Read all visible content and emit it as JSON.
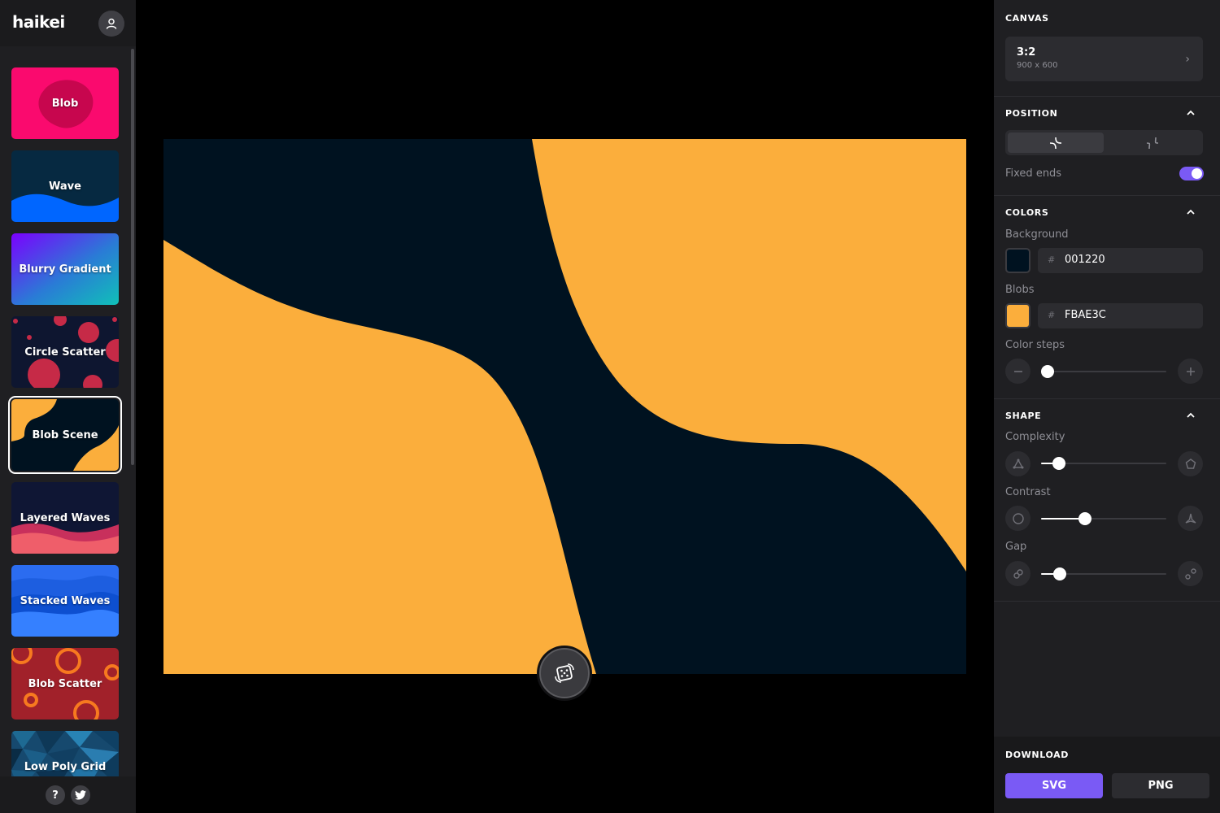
{
  "app": {
    "logo": "haikei"
  },
  "sidebar": {
    "items": [
      {
        "label": "Blob",
        "icon": "blob-thumb"
      },
      {
        "label": "Wave",
        "icon": "wave-thumb"
      },
      {
        "label": "Blurry Gradient",
        "icon": "blurry-gradient-thumb"
      },
      {
        "label": "Circle Scatter",
        "icon": "circle-scatter-thumb"
      },
      {
        "label": "Blob Scene",
        "icon": "blob-scene-thumb",
        "selected": true
      },
      {
        "label": "Layered Waves",
        "icon": "layered-waves-thumb"
      },
      {
        "label": "Stacked Waves",
        "icon": "stacked-waves-thumb"
      },
      {
        "label": "Blob Scatter",
        "icon": "blob-scatter-thumb"
      },
      {
        "label": "Low Poly Grid",
        "icon": "low-poly-grid-thumb"
      }
    ],
    "footer": {
      "help_label": "?",
      "help_icon": "help-icon",
      "twitter_icon": "twitter-icon"
    }
  },
  "canvas_preview": {
    "background": "#001220",
    "blob_color": "#FBAE3C",
    "randomize_icon": "dice-icon"
  },
  "panel": {
    "canvas": {
      "title": "CANVAS",
      "ratio": "3:2",
      "size": "900 x 600"
    },
    "position": {
      "title": "POSITION",
      "fixed_ends_label": "Fixed ends",
      "fixed_ends": true
    },
    "colors": {
      "title": "COLORS",
      "background_label": "Background",
      "background_hash": "#",
      "background_hex": "001220",
      "blobs_label": "Blobs",
      "blobs_hash": "#",
      "blobs_hex": "FBAE3C",
      "color_steps_label": "Color steps",
      "color_steps_level": 0
    },
    "shape": {
      "title": "SHAPE",
      "complexity_label": "Complexity",
      "complexity_level": 0.1,
      "contrast_label": "Contrast",
      "contrast_level": 0.33,
      "gap_label": "Gap",
      "gap_level": 0.11
    },
    "download": {
      "title": "DOWNLOAD",
      "svg_label": "SVG",
      "png_label": "PNG"
    }
  },
  "colors": {
    "accent": "#7A5AF5",
    "panel_bg": "#1F1F22"
  }
}
